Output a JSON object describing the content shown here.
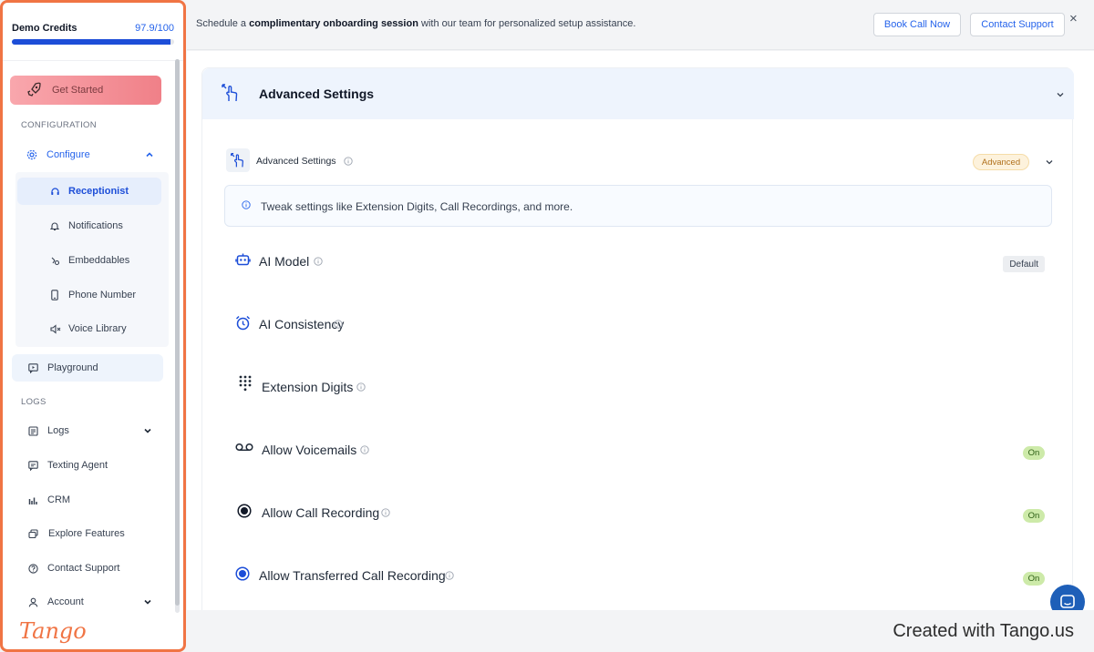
{
  "sidebar": {
    "credits": {
      "label": "Demo Credits",
      "value": "97.9/100",
      "fraction": 0.979
    },
    "get_started": "Get Started",
    "sections": {
      "configuration": "CONFIGURATION",
      "logs": "LOGS"
    },
    "configure": "Configure",
    "sub_items": [
      "Receptionist",
      "Notifications",
      "Embeddables",
      "Phone Number",
      "Voice Library"
    ],
    "playground": "Playground",
    "logs_items": [
      "Logs",
      "Texting Agent",
      "CRM",
      "Explore Features",
      "Contact Support",
      "Account"
    ],
    "brand": "Tango"
  },
  "banner": {
    "pre": "Schedule a ",
    "bold": "complimentary onboarding session",
    "post": " with our team for personalized setup assistance.",
    "book": "Book Call Now",
    "contact": "Contact Support",
    "close": "×"
  },
  "card": {
    "title": "Advanced Settings",
    "sub_title": "Advanced Settings",
    "badge": "Advanced",
    "info": "Tweak settings like Extension Digits, Call Recordings, and more.",
    "rows": [
      {
        "label": "AI Model",
        "badge": "Default"
      },
      {
        "label": "AI Consistency",
        "badge": ""
      },
      {
        "label": "Extension Digits",
        "badge": ""
      },
      {
        "label": "Allow Voicemails",
        "badge": "On"
      },
      {
        "label": "Allow Call Recording",
        "badge": "On"
      },
      {
        "label": "Allow Transferred Call Recording",
        "badge": "On"
      }
    ]
  },
  "footer": {
    "credit": "Created with Tango.us"
  },
  "colors": {
    "accent": "#2563eb",
    "tango": "#f07444",
    "on_badge": "#cdeaa9",
    "get_started": "#f08088"
  }
}
